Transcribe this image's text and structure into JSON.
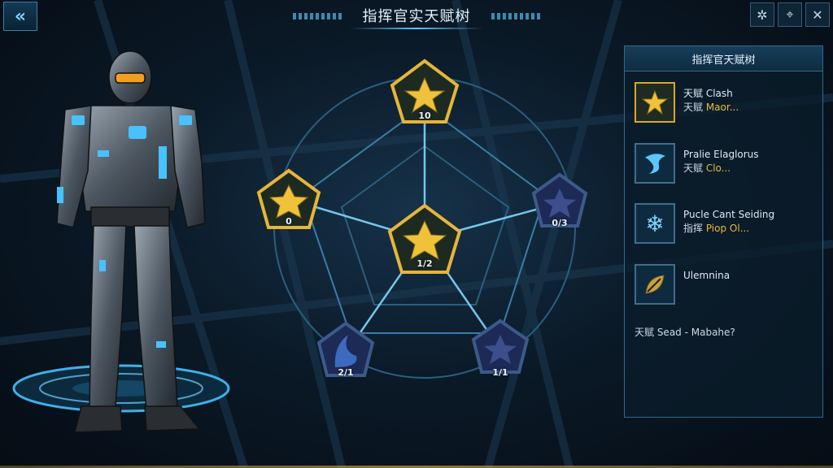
{
  "header": {
    "title": "指挥官实天赋树",
    "back_icon": "double-chevron-left-icon"
  },
  "top_icons": [
    "gear-icon",
    "target-icon",
    "close-icon"
  ],
  "tree": {
    "nodes": [
      {
        "id": "top",
        "label": "10",
        "state": "gold"
      },
      {
        "id": "left",
        "label": "0",
        "state": "gold"
      },
      {
        "id": "center",
        "label": "1/2",
        "state": "gold"
      },
      {
        "id": "right",
        "label": "0/3",
        "state": "locked"
      },
      {
        "id": "bottom-left",
        "label": "2/1",
        "state": "locked"
      },
      {
        "id": "bottom-right",
        "label": "1/1",
        "state": "locked"
      }
    ]
  },
  "panel": {
    "title": "指挥官天赋树",
    "talents": [
      {
        "name": "天赋 Clash",
        "desc_prefix": "天赋 ",
        "desc_highlight": "Maor...",
        "icon": "star-icon"
      },
      {
        "name": "Pralie Elaglorus",
        "desc_prefix": "天赋 ",
        "desc_highlight": "Clo...",
        "icon": "wave-icon"
      },
      {
        "name": "Pucle Cant Seiding",
        "desc_prefix": "指挥 ",
        "desc_highlight": "Piop Ol...",
        "icon": "snowflake-icon"
      },
      {
        "name": "Ulemnina",
        "desc_prefix": "",
        "desc_highlight": "",
        "icon": "leaf-icon"
      }
    ],
    "footer": "天赋 Sead - Mabahe?"
  },
  "colors": {
    "gold": "#e6b53a",
    "blue": "#5cc8ff",
    "navy": "#1c2a55"
  }
}
